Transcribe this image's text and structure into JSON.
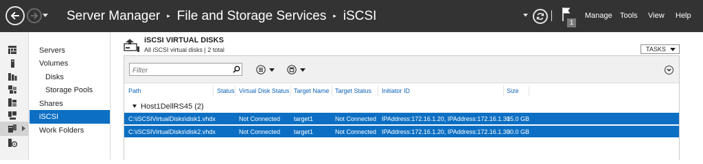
{
  "titlebar": {
    "breadcrumb": [
      "Server Manager",
      "File and Storage Services",
      "iSCSI"
    ],
    "separator": "▸",
    "notification_count": "1",
    "menu": [
      "Manage",
      "Tools",
      "View",
      "Help"
    ]
  },
  "rail": {
    "icons": [
      "dashboard-icon",
      "local-server-icon",
      "all-servers-icon",
      "file-services-icon",
      "iis-icon",
      "remote-access-icon",
      "file-storage-icon",
      "wds-icon"
    ],
    "active_index": 6
  },
  "nav": {
    "items": [
      {
        "label": "Servers",
        "level": 0,
        "selected": false
      },
      {
        "label": "Volumes",
        "level": 0,
        "selected": false
      },
      {
        "label": "Disks",
        "level": 1,
        "selected": false
      },
      {
        "label": "Storage Pools",
        "level": 1,
        "selected": false
      },
      {
        "label": "Shares",
        "level": 0,
        "selected": false
      },
      {
        "label": "iSCSI",
        "level": 0,
        "selected": true
      },
      {
        "label": "Work Folders",
        "level": 0,
        "selected": false
      }
    ]
  },
  "section": {
    "title": "iSCSI VIRTUAL DISKS",
    "subtitle": "All iSCSI virtual disks | 2 total",
    "tasks_label": "TASKS"
  },
  "filter": {
    "placeholder": "Filter"
  },
  "table": {
    "columns": [
      "Path",
      "Status",
      "Virtual Disk Status",
      "Target Name",
      "Target Status",
      "Initiator ID",
      "Size"
    ],
    "group": {
      "label": "Host1DellRS45 (2)"
    },
    "rows": [
      {
        "path": "C:\\iSCSIVirtualDisks\\disk1.vhdx",
        "status": "",
        "virtual_disk_status": "Not Connected",
        "target_name": "target1",
        "target_status": "Not Connected",
        "initiator_id": "IPAddress:172.16.1.20, IPAddress:172.16.1.30",
        "size": "15.0 GB"
      },
      {
        "path": "C:\\iSCSIVirtualDisks\\disk2.vhdx",
        "status": "",
        "virtual_disk_status": "Not Connected",
        "target_name": "target1",
        "target_status": "Not Connected",
        "initiator_id": "IPAddress:172.16.1.20, IPAddress:172.16.1.30",
        "size": "30.0 GB"
      }
    ]
  },
  "colors": {
    "titlebar_bg": "#333333",
    "selection": "#0c6fc3",
    "header_link": "#0b62b8"
  }
}
